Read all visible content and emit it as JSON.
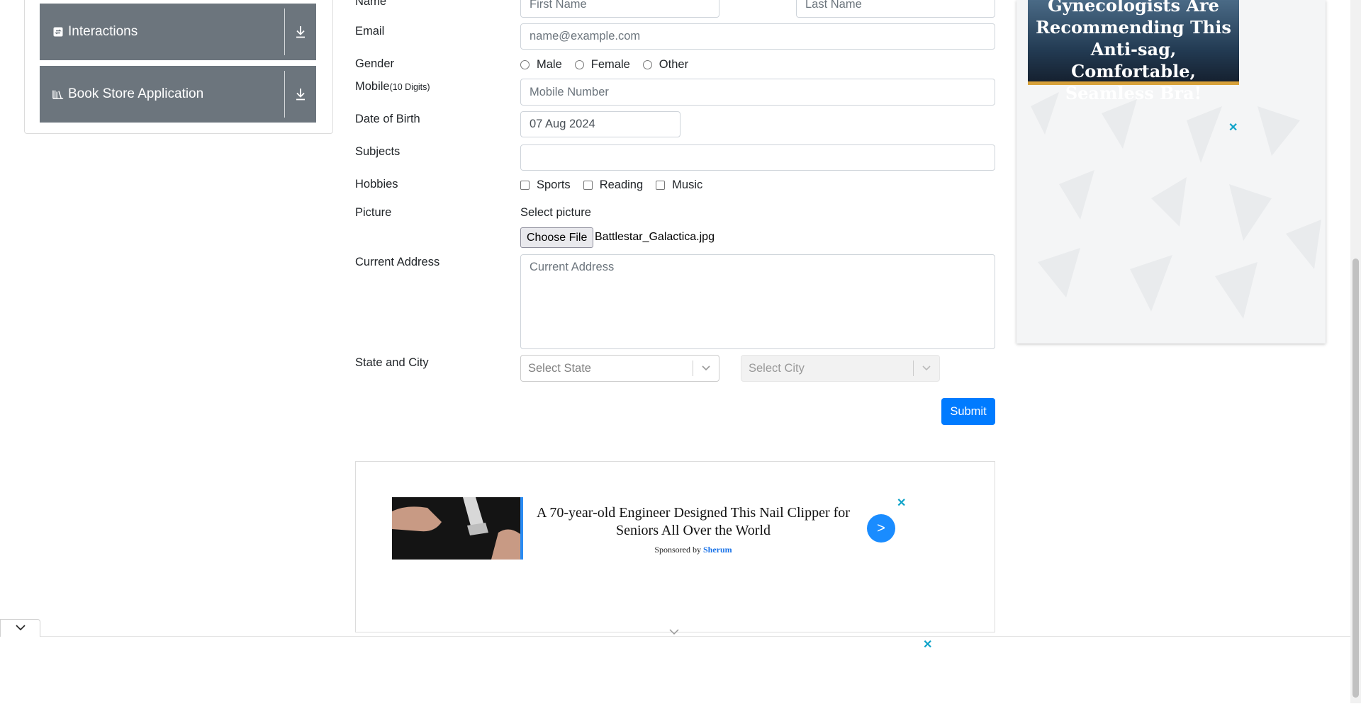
{
  "sidebar": {
    "groups": [
      {
        "label": "Interactions",
        "icon": "interactions-icon"
      },
      {
        "label": "Book Store Application",
        "icon": "book-store-icon"
      }
    ]
  },
  "form": {
    "name_label": "Name",
    "first_name_placeholder": "First Name",
    "last_name_placeholder": "Last Name",
    "email_label": "Email",
    "email_placeholder": "name@example.com",
    "gender_label": "Gender",
    "gender_options": [
      "Male",
      "Female",
      "Other"
    ],
    "mobile_label": "Mobile",
    "mobile_hint": "(10 Digits)",
    "mobile_placeholder": "Mobile Number",
    "dob_label": "Date of Birth",
    "dob_value": "07 Aug 2024",
    "subjects_label": "Subjects",
    "subjects_value": "",
    "hobbies_label": "Hobbies",
    "hobbies_options": [
      "Sports",
      "Reading",
      "Music"
    ],
    "picture_label": "Picture",
    "select_picture_label": "Select picture",
    "choose_file_label": "Choose File",
    "file_name": "Battlestar_Galactica.jpg",
    "address_label": "Current Address",
    "address_placeholder": "Current Address",
    "state_city_label": "State and City",
    "state_placeholder": "Select State",
    "city_placeholder": "Select City",
    "submit_label": "Submit"
  },
  "ads": {
    "right_headline": "Gynecologists Are Recommending This Anti-sag, Comfortable, Seamless Bra!",
    "bottom_headline": "A 70-year-old Engineer Designed This Nail Clipper for Seniors All Over the World",
    "bottom_sponsor_prefix": "Sponsored by",
    "bottom_sponsor_name": "Sherum",
    "bottom_cta": ">",
    "close_symbol": "✕"
  },
  "colors": {
    "sidebar_header_bg": "#6c757d",
    "submit_bg": "#007bff",
    "ad_close": "#0fa3c9"
  }
}
